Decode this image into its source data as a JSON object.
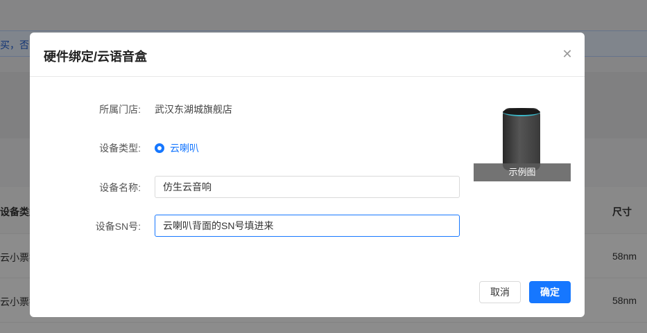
{
  "background": {
    "notice_text": "买，否贝",
    "table_headers": {
      "type": "设备类型",
      "size": "尺寸"
    },
    "rows": [
      {
        "type": "云小票打",
        "size": "58nm"
      },
      {
        "type": "云小票打",
        "size": "58nm"
      }
    ]
  },
  "dialog": {
    "title": "硬件绑定/云语音盒",
    "close_icon": "close-icon",
    "form": {
      "store_label": "所属门店:",
      "store_value": "武汉东湖城旗舰店",
      "type_label": "设备类型:",
      "type_option": "云喇叭",
      "name_label": "设备名称:",
      "name_value": "仿生云音响",
      "sn_label": "设备SN号:",
      "sn_value": "云喇叭背面的SN号填进来"
    },
    "example_caption": "示例图",
    "buttons": {
      "cancel": "取消",
      "ok": "确定"
    }
  },
  "colors": {
    "accent": "#1677ff",
    "overlay": "rgba(0,0,0,0.45)"
  }
}
